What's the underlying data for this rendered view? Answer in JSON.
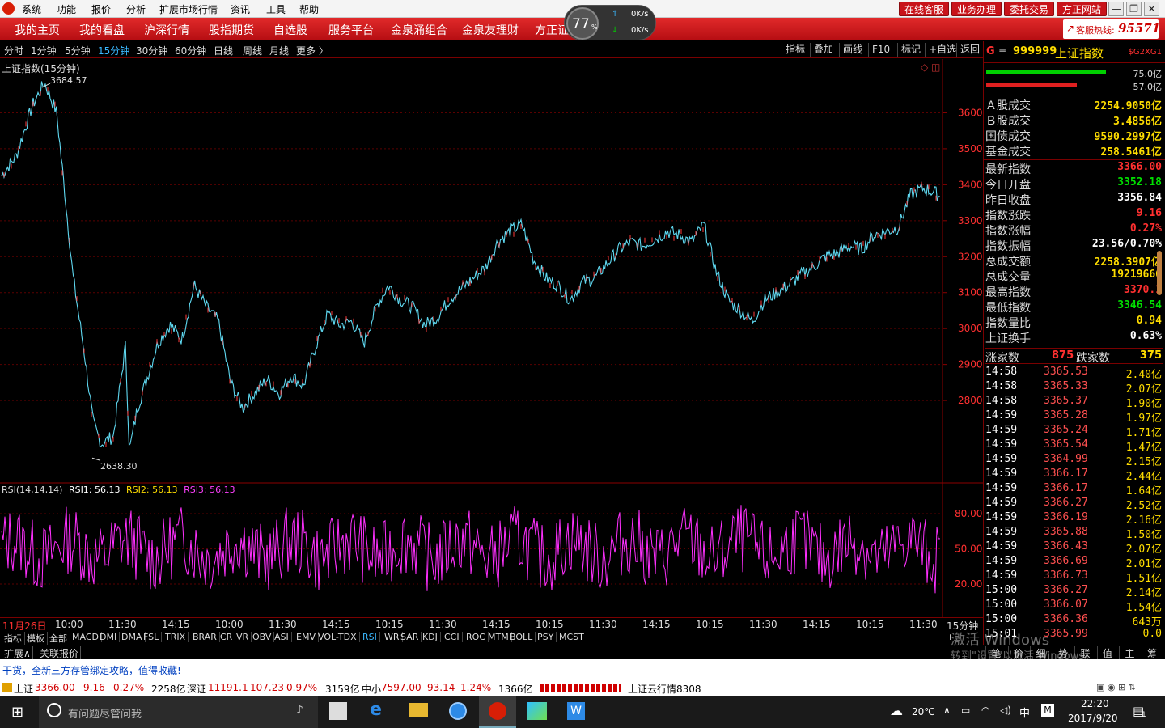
{
  "titlebar": {
    "menus": [
      "系统",
      "功能",
      "报价",
      "分析",
      "扩展市场行情",
      "资讯",
      "工具",
      "帮助"
    ],
    "right_buttons": [
      "在线客服",
      "业务办理",
      "委托交易",
      "方正网站"
    ],
    "window_buttons": [
      "—",
      "❐",
      "✕"
    ]
  },
  "navbar": {
    "items": [
      "我的主页",
      "我的看盘",
      "沪深行情",
      "股指期货",
      "自选股",
      "服务平台",
      "金泉涌组合",
      "金泉友理财",
      "方正证"
    ],
    "hotline_label": "客服热线:",
    "hotline_number": "95571"
  },
  "gauge": {
    "percent": "77",
    "unit": "%",
    "up_rate": "0K/s",
    "down_rate": "0K/s"
  },
  "period_tabs": [
    "分时",
    "1分钟",
    "5分钟",
    "15分钟",
    "30分钟",
    "60分钟",
    "日线",
    "周线",
    "月线",
    "更多 〉"
  ],
  "active_period": "15分钟",
  "chart_tools": [
    "指标",
    "叠加",
    "画线",
    "F10",
    "标记",
    "+自选",
    "返回"
  ],
  "main_chart": {
    "title": "上证指数(15分钟)",
    "high_label": "3684.57",
    "low_label": "2638.30",
    "y_ticks": [
      "3600",
      "3500",
      "3400",
      "3300",
      "3200",
      "3100",
      "3000",
      "2900",
      "2800"
    ]
  },
  "rsi_panel": {
    "label": "RSI(14,14,14)",
    "rsi1": "RSI1: 56.13",
    "rsi2": "RSI2: 56.13",
    "rsi3": "RSI3: 56.13",
    "y_ticks": [
      "80.00",
      "50.00",
      "20.00"
    ]
  },
  "x_axis": {
    "labels": [
      "11月26日",
      "10:00",
      "11:30",
      "14:15",
      "10:00",
      "11:30",
      "14:15",
      "10:15",
      "11:30",
      "14:15",
      "10:15",
      "11:30",
      "14:15",
      "10:15",
      "11:30",
      "14:15",
      "10:15",
      "11:30"
    ],
    "period": "15分钟"
  },
  "indicator_tabs": [
    "指标",
    "模板",
    "全部",
    "MACD",
    "DMI",
    "DMA",
    "FSL",
    "TRIX",
    "BRAR",
    "CR",
    "VR",
    "OBV",
    "ASI",
    "EMV",
    "VOL-TDX",
    "RSI",
    "WR",
    "SAR",
    "KDJ",
    "CCI",
    "ROC",
    "MTM",
    "BOLL",
    "PSY",
    "MCST"
  ],
  "active_indicator": "RSI",
  "ext_tabs": [
    "扩展∧",
    "关联报价"
  ],
  "right_panel": {
    "code": "999999",
    "name": "上证指数",
    "tag": "$G2XG1",
    "bar_pct_1": "75.0亿",
    "bar_pct_2": "57.0亿",
    "turnover": [
      {
        "label": "Ａ股成交",
        "value": "2254.9050亿"
      },
      {
        "label": "Ｂ股成交",
        "value": "3.4856亿"
      },
      {
        "label": "国债成交",
        "value": "9590.2997亿"
      },
      {
        "label": "基金成交",
        "value": "258.5461亿"
      }
    ],
    "quote": [
      {
        "label": "最新指数",
        "value": "3366.00",
        "color": "red"
      },
      {
        "label": "今日开盘",
        "value": "3352.18",
        "color": "grn"
      },
      {
        "label": "昨日收盘",
        "value": "3356.84",
        "color": "wht"
      },
      {
        "label": "指数涨跌",
        "value": "9.16",
        "color": "red"
      },
      {
        "label": "指数涨幅",
        "value": "0.27%",
        "color": "red"
      },
      {
        "label": "指数振幅",
        "value": "23.56/0.70%",
        "color": "wht"
      },
      {
        "label": "总成交额",
        "value": "2258.3907亿",
        "color": "yel"
      },
      {
        "label": "总成交量",
        "value": "19219666",
        "color": "yel"
      },
      {
        "label": "最高指数",
        "value": "3370.1",
        "color": "red"
      },
      {
        "label": "最低指数",
        "value": "3346.54",
        "color": "grn"
      },
      {
        "label": "指数量比",
        "value": "0.94",
        "color": "yel"
      },
      {
        "label": "上证换手",
        "value": "0.63%",
        "color": "wht"
      }
    ],
    "adv_label": "涨家数",
    "adv_value": "875",
    "dec_label": "跌家数",
    "dec_value": "375",
    "ticks": [
      {
        "t": "14:58",
        "p": "3365.53",
        "v": "2.40亿"
      },
      {
        "t": "14:58",
        "p": "3365.33",
        "v": "2.07亿"
      },
      {
        "t": "14:58",
        "p": "3365.37",
        "v": "1.90亿"
      },
      {
        "t": "14:59",
        "p": "3365.28",
        "v": "1.97亿"
      },
      {
        "t": "14:59",
        "p": "3365.24",
        "v": "1.71亿"
      },
      {
        "t": "14:59",
        "p": "3365.54",
        "v": "1.47亿"
      },
      {
        "t": "14:59",
        "p": "3364.99",
        "v": "2.15亿"
      },
      {
        "t": "14:59",
        "p": "3366.17",
        "v": "2.44亿"
      },
      {
        "t": "14:59",
        "p": "3366.17",
        "v": "1.64亿"
      },
      {
        "t": "14:59",
        "p": "3366.27",
        "v": "2.52亿"
      },
      {
        "t": "14:59",
        "p": "3366.19",
        "v": "2.16亿"
      },
      {
        "t": "14:59",
        "p": "3365.88",
        "v": "1.50亿"
      },
      {
        "t": "14:59",
        "p": "3366.43",
        "v": "2.07亿"
      },
      {
        "t": "14:59",
        "p": "3366.69",
        "v": "2.01亿"
      },
      {
        "t": "14:59",
        "p": "3366.73",
        "v": "1.51亿"
      },
      {
        "t": "15:00",
        "p": "3366.27",
        "v": "2.14亿"
      },
      {
        "t": "15:00",
        "p": "3366.07",
        "v": "1.54亿"
      },
      {
        "t": "15:00",
        "p": "3366.36",
        "v": "643万"
      },
      {
        "t": "15:01",
        "p": "3365.99",
        "v": "0.0"
      }
    ],
    "bottom_tabs": [
      "笔",
      "价",
      "细",
      "势",
      "联",
      "值",
      "主",
      "筹"
    ]
  },
  "watermark": {
    "line1": "激活 Windows",
    "line2": "转到\"设置\"以激活 Windows。"
  },
  "news": "干货，全新三方存管绑定攻略，值得收藏!",
  "statusbar": {
    "sh_label": "上证",
    "sh_price": "3366.00",
    "sh_chg": "9.16",
    "sh_pct": "0.27%",
    "sh_amt": "2258亿",
    "sz_label": "深证",
    "sz_price": "11191.1",
    "sz_chg": "107.23",
    "sz_pct": "0.97%",
    "sz_amt": "3159亿",
    "zx_label": "中小",
    "zx_price": "7597.00",
    "zx_chg": "93.14",
    "zx_pct": "1.24%",
    "zx_amt": "1366亿",
    "cloud": "上证云行情8308"
  },
  "taskbar": {
    "search_placeholder": "有问题尽管问我",
    "weather": "20℃",
    "ime": "中",
    "time": "22:20",
    "date": "2017/9/20",
    "notif_count": "1"
  },
  "chart_data": {
    "type": "line",
    "series": [
      {
        "x": [
          0,
          20,
          40,
          55,
          70,
          80,
          90,
          105,
          115,
          125,
          140,
          155,
          160,
          170,
          180,
          195,
          210,
          225,
          240,
          255,
          270,
          285,
          300,
          315,
          330,
          345,
          360,
          375,
          390,
          405,
          420,
          435,
          450,
          465,
          480,
          495,
          510,
          525,
          540,
          555,
          570,
          585,
          600,
          615,
          630,
          645,
          660,
          675,
          690,
          705,
          720,
          735,
          750,
          765,
          780,
          795,
          810,
          825,
          840,
          855,
          870,
          885,
          900,
          915,
          930,
          945,
          960,
          975,
          990,
          1005,
          1020,
          1035,
          1050,
          1065,
          1080,
          1095,
          1110,
          1125,
          1140,
          1155,
          1162
        ],
        "values": [
          3420,
          3480,
          3620,
          3684,
          3600,
          3380,
          3150,
          2920,
          2740,
          2680,
          2700,
          2950,
          2660,
          2780,
          2850,
          2960,
          3010,
          2970,
          3120,
          3060,
          3020,
          2850,
          2780,
          2820,
          2860,
          2820,
          2870,
          2840,
          2950,
          3040,
          3010,
          3020,
          2960,
          3060,
          3120,
          3080,
          3060,
          3010,
          3030,
          3080,
          3110,
          3140,
          3170,
          3240,
          3270,
          3290,
          3190,
          3140,
          3120,
          3080,
          3130,
          3140,
          3180,
          3220,
          3240,
          3230,
          3250,
          3270,
          3260,
          3240,
          3290,
          3160,
          3080,
          3050,
          3020,
          3080,
          3100,
          3120,
          3150,
          3170,
          3200,
          3210,
          3230,
          3220,
          3260,
          3270,
          3280,
          3370,
          3390,
          3380,
          3366
        ]
      }
    ],
    "ylim": [
      2600,
      3700
    ],
    "rsi_ylim": [
      0,
      100
    ]
  }
}
